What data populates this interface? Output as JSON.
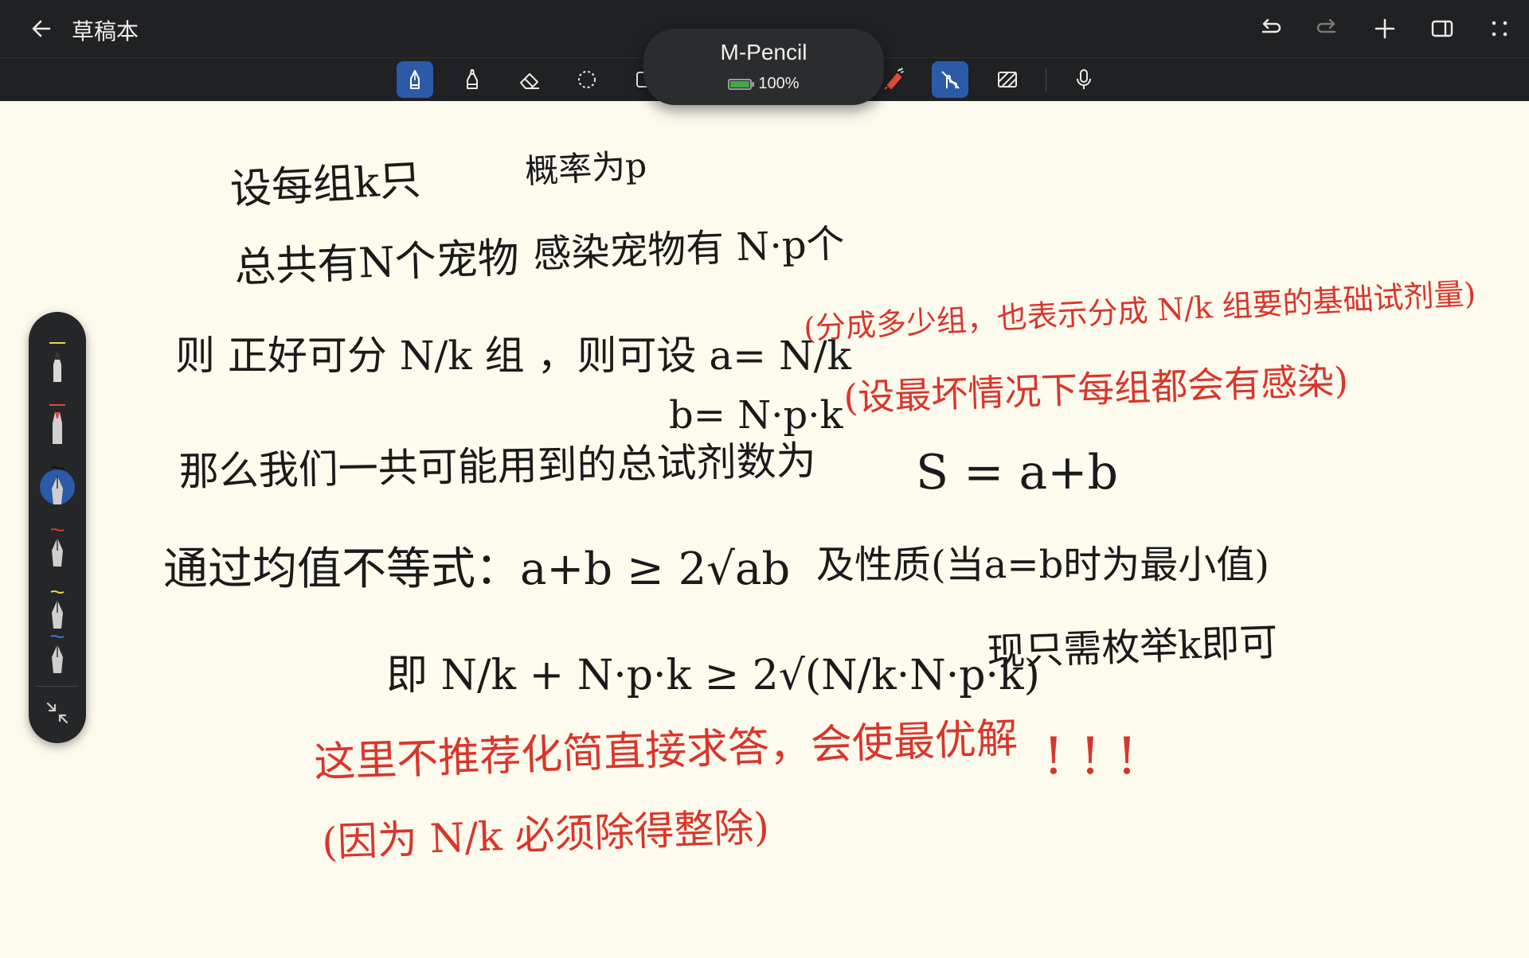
{
  "app": {
    "title": "草稿本"
  },
  "titlebar_icons": [
    "back-arrow-icon",
    "undo-icon",
    "redo-icon",
    "add-icon",
    "split-view-icon",
    "more-icon"
  ],
  "toolbar": {
    "tools": [
      "pen-icon",
      "highlighter-icon",
      "eraser-icon",
      "lasso-icon",
      "shape-icon",
      "pencil-icon",
      "finger-draw-icon",
      "texture-icon",
      "microphone-icon"
    ],
    "active_tool": "pen-icon",
    "finger_mode_active": true
  },
  "pencil_popup": {
    "device": "M-Pencil",
    "battery": "100%"
  },
  "palette": {
    "pens": [
      {
        "type": "pencil",
        "color": "#f3d34a"
      },
      {
        "type": "marker",
        "color": "#e0463c"
      },
      {
        "type": "fountain",
        "color": "#111111",
        "active": true
      },
      {
        "type": "fountain",
        "color": "#d9362b"
      },
      {
        "type": "fountain",
        "color": "#f2d53c"
      },
      {
        "type": "fountain",
        "color": "#2f7ad6"
      }
    ]
  },
  "note": {
    "black_lines": [
      "设每组k只",
      "概率为p",
      "总共有N个宠物",
      "感染宠物有 N·p个",
      "则 正好可分 N/k 组 ，则可设 a= N/k",
      "b= N·p·k",
      "那么我们一共可能用到的总试剂数为",
      "S = a+b",
      "通过均值不等式：a+b ≥ 2√ab",
      "及性质(当a=b时为最小值)",
      "即 N/k + N·p·k ≥ 2√(N/k·N·p·k)",
      "现只需枚举k即可"
    ],
    "red_lines": [
      "(分成多少组，也表示分成 N/k 组要的基础试剂量)",
      "(设最坏情况下每组都会有感染)",
      "这里不推荐化简直接求答，会使最优解",
      "! ! !",
      "(因为 N/k 必须除得整除)"
    ]
  }
}
